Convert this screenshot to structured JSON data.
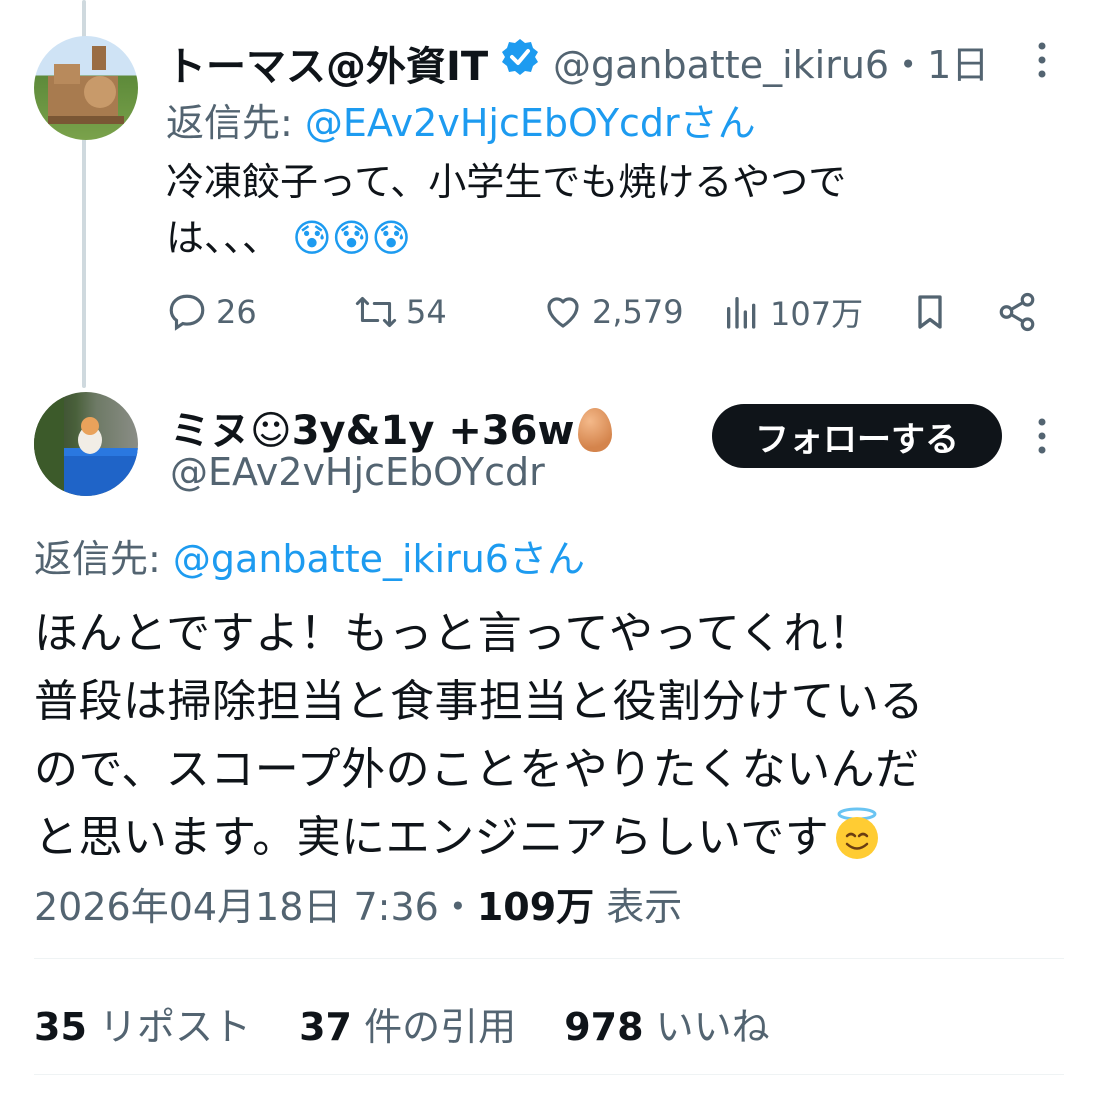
{
  "tweet1": {
    "name": "トーマス@外資IT",
    "handle": "@ganbatte_ikiru6",
    "time": "・1日",
    "reply_label": "返信先:",
    "reply_mention": "@EAv2vHjcEbOYcdrさん",
    "text_line1": "冷凍餃子って、小学生でも焼けるやつで",
    "text_line2": "は、、、",
    "emoji": "😰😰😰",
    "stats": {
      "replies": "26",
      "reposts": "54",
      "likes": "2,579",
      "views": "107万"
    },
    "icons": [
      "verified-badge-icon",
      "more-icon",
      "reply-icon",
      "repost-icon",
      "like-icon",
      "views-icon",
      "bookmark-icon",
      "share-icon"
    ]
  },
  "tweet2": {
    "name": "ミヌ☺3y&1y +36w",
    "name_emoji": "egg-icon",
    "handle": "@EAv2vHjcEbOYcdr",
    "follow_label": "フォローする",
    "reply_label": "返信先:",
    "reply_mention": "@ganbatte_ikiru6さん",
    "text_line1": "ほんとですよ！もっと言ってやってくれ！",
    "text_line2": "普段は掃除担当と食事担当と役割分けている",
    "text_line3": "ので、スコープ外のことをやりたくないんだ",
    "text_line4": "と思います。実にエンジニアらしいです",
    "end_emoji": "smiling-face-with-halo-icon",
    "timestamp": "2026年04月18日 7:36",
    "sep": "・",
    "views_count": "109万",
    "views_label": "表示",
    "reposts_count": "35",
    "reposts_label": "リポスト",
    "quotes_count": "37",
    "quotes_label": "件の引用",
    "likes_count": "978",
    "likes_label": "いいね"
  },
  "colors": {
    "text": "#0f1419",
    "secondary": "#536471",
    "accent": "#1d9bf0",
    "thread_line": "#cfd9de",
    "button_bg": "#0f1419"
  }
}
